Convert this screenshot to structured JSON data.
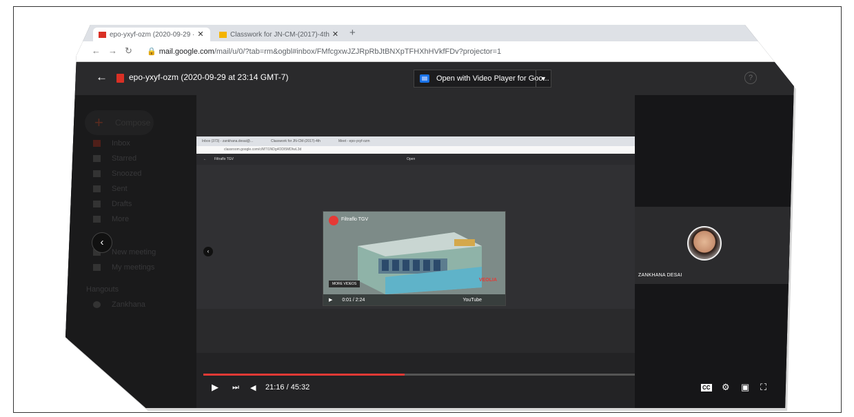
{
  "browser": {
    "tabs": [
      {
        "label": "epo-yxyf-ozm (2020-09-29 ·",
        "close": "✕"
      },
      {
        "label": "Classwork for JN-CM-(2017)-4th",
        "close": "✕"
      }
    ],
    "new_tab": "+",
    "url_host": "mail.google.com",
    "url_path": "/mail/u/0/?tab=rm&ogbl#inbox/FMfcgxwJZJRpRbJtBNXpTFHXhHVkfFDv?projector=1"
  },
  "viewer": {
    "back": "←",
    "file_title": "epo-yxyf-ozm (2020-09-29 at 23:14 GMT-7)",
    "open_with": "Open with Video Player for Goo...",
    "open_with_caret": "▼",
    "help": "?"
  },
  "gmail": {
    "compose": "Compose",
    "items": [
      "Inbox",
      "Starred",
      "Snoozed",
      "Sent",
      "Drafts",
      "More"
    ],
    "meet_items": [
      "New meeting",
      "My meetings"
    ],
    "hangouts": "Hangouts",
    "hangout_user": "Zankhana"
  },
  "inner_screen": {
    "tabs": [
      "Inbox (373) - zankhana.desai@...",
      "Classwork for JN-CM-(2017)-4th",
      "Meet - epo-yxyf-ozm"
    ],
    "url": "classroom.google.com/c/MTI1NDg4ODI5MDIwL3d",
    "header_title": "Filtraflo TGV",
    "open_label": "Open",
    "video_title": "Filtraflo TGV",
    "more_videos": "MORE VIDEOS",
    "video_time": "0:01 / 2:24",
    "brand": "VEOLIA",
    "youtube": "YouTube"
  },
  "meet": {
    "participant_name": "ZANKHANA DESAI"
  },
  "player": {
    "time": "21:16 / 45:32",
    "progress": 0.467,
    "play_icon": "▶",
    "next_icon": "⏭",
    "volume_icon": "◀",
    "cc": "CC",
    "settings_icon": "⚙",
    "miniplayer_icon": "▣",
    "fullscreen_icon": "⛶"
  },
  "colors": {
    "progress_red": "#e53935",
    "viewer_bg": "#202124",
    "accent_blue": "#1a73e8"
  }
}
